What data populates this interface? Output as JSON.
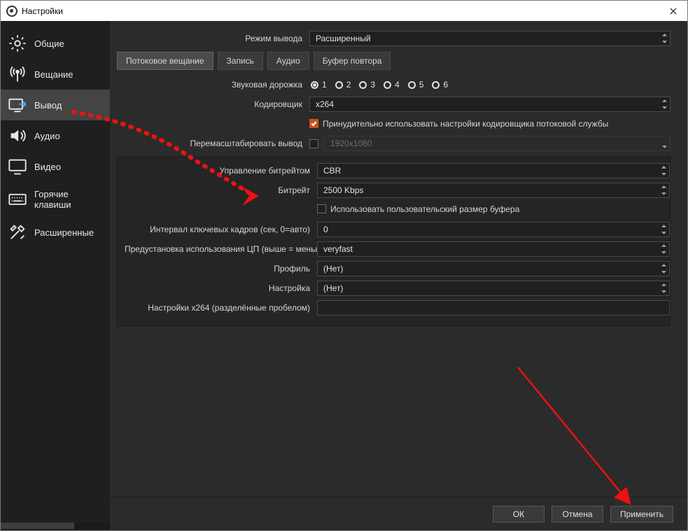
{
  "window": {
    "title": "Настройки"
  },
  "sidebar": {
    "items": [
      {
        "label": "Общие"
      },
      {
        "label": "Вещание"
      },
      {
        "label": "Вывод"
      },
      {
        "label": "Аудио"
      },
      {
        "label": "Видео"
      },
      {
        "label": "Горячие клавиши"
      },
      {
        "label": "Расширенные"
      }
    ]
  },
  "output": {
    "mode_label": "Режим вывода",
    "mode_value": "Расширенный",
    "tabs": [
      {
        "label": "Потоковое вещание"
      },
      {
        "label": "Запись"
      },
      {
        "label": "Аудио"
      },
      {
        "label": "Буфер повтора"
      }
    ],
    "track_label": "Звуковая дорожка",
    "tracks": [
      "1",
      "2",
      "3",
      "4",
      "5",
      "6"
    ],
    "encoder_label": "Кодировщик",
    "encoder_value": "x264",
    "enforce_label": "Принудительно использовать настройки кодировщика потоковой службы",
    "rescale_label": "Перемасштабировать вывод",
    "rescale_value": "1920x1080",
    "group": {
      "rate_ctrl_label": "Управление битрейтом",
      "rate_ctrl_value": "CBR",
      "bitrate_label": "Битрейт",
      "bitrate_value": "2500 Kbps",
      "custom_buf_label": "Использовать пользовательский размер буфера",
      "keyint_label": "Интервал ключевых кадров (сек, 0=авто)",
      "keyint_value": "0",
      "preset_label": "Предустановка использования ЦП (выше = меньше)",
      "preset_value": "veryfast",
      "profile_label": "Профиль",
      "profile_value": "(Нет)",
      "tune_label": "Настройка",
      "tune_value": "(Нет)",
      "x264opts_label": "Настройки x264 (разделённые пробелом)",
      "x264opts_value": ""
    }
  },
  "footer": {
    "ok": "ОК",
    "cancel": "Отмена",
    "apply": "Применить"
  }
}
